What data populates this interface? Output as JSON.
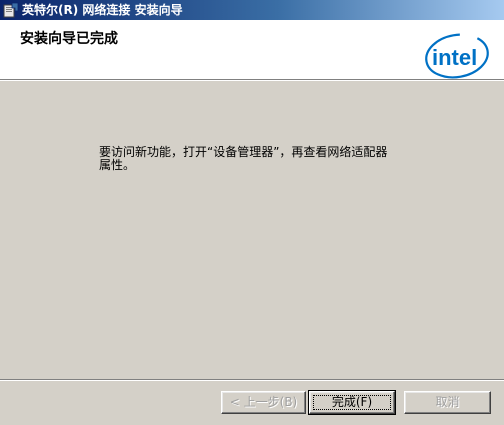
{
  "window": {
    "title": "英特尔(R) 网络连接 安装向导"
  },
  "header": {
    "title": "安装向导已完成",
    "logo_text": "intel"
  },
  "main": {
    "message": "要访问新功能，打开“设备管理器”，再查看网络适配器属性。"
  },
  "footer": {
    "back_label": "< 上一步(B)",
    "finish_label": "完成(F)",
    "cancel_label": "取消"
  },
  "colors": {
    "titlebar_start": "#0a246a",
    "titlebar_end": "#a6caf0",
    "intel_blue": "#0071c5",
    "dialog_bg": "#d4d0c8"
  }
}
